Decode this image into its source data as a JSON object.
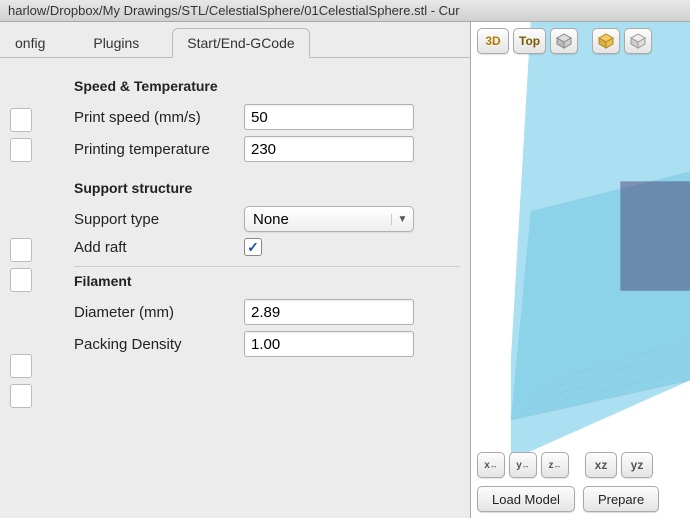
{
  "window": {
    "title": "harlow/Dropbox/My Drawings/STL/CelestialSphere/01CelestialSphere.stl - Cur"
  },
  "tabs": {
    "config": "onfig",
    "plugins": "Plugins",
    "gcode": "Start/End-GCode"
  },
  "sections": {
    "speed_temp": "Speed & Temperature",
    "support": "Support structure",
    "filament": "Filament"
  },
  "fields": {
    "print_speed": {
      "label": "Print speed (mm/s)",
      "value": "50"
    },
    "printing_temp": {
      "label": "Printing temperature",
      "value": "230"
    },
    "support_type": {
      "label": "Support type",
      "value": "None"
    },
    "add_raft": {
      "label": "Add raft",
      "checked": "✓"
    },
    "diameter": {
      "label": "Diameter (mm)",
      "value": "2.89"
    },
    "packing_density": {
      "label": "Packing Density",
      "value": "1.00"
    }
  },
  "toolbar3d": {
    "btn_3d": "3D",
    "btn_top": "Top"
  },
  "mirror_toolbar": {
    "x": "x",
    "y": "y",
    "z": "z",
    "xz": "xz",
    "yz": "yz"
  },
  "buttons": {
    "load": "Load Model",
    "prepare": "Prepare"
  },
  "colors": {
    "accent": "#6ac8ea",
    "check": "#1a4db3"
  }
}
